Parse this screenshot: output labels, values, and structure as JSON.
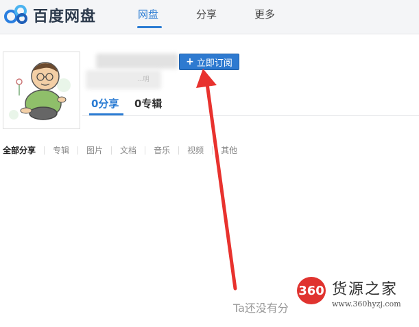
{
  "header": {
    "brand": "百度网盘",
    "nav": [
      {
        "label": "网盘",
        "active": true
      },
      {
        "label": "分享",
        "active": false
      },
      {
        "label": "更多",
        "active": false
      }
    ]
  },
  "profile": {
    "subscribe_label": "立即订阅",
    "blurred_hint": "...明",
    "stats": {
      "shares": "0分享",
      "albums": "0专辑"
    }
  },
  "filters": [
    "全部分享",
    "专辑",
    "图片",
    "文档",
    "音乐",
    "视频",
    "其他"
  ],
  "empty_state": "Ta还没有分",
  "watermark": {
    "badge": "360",
    "title": "货源之家",
    "url": "www.360hyzj.com"
  },
  "colors": {
    "accent": "#2b7cd3",
    "arrow": "#e8322e",
    "watermark_red": "#e0332f"
  },
  "icons": {
    "logo": "baidu-netdisk-logo",
    "subscribe": "plus-icon"
  }
}
